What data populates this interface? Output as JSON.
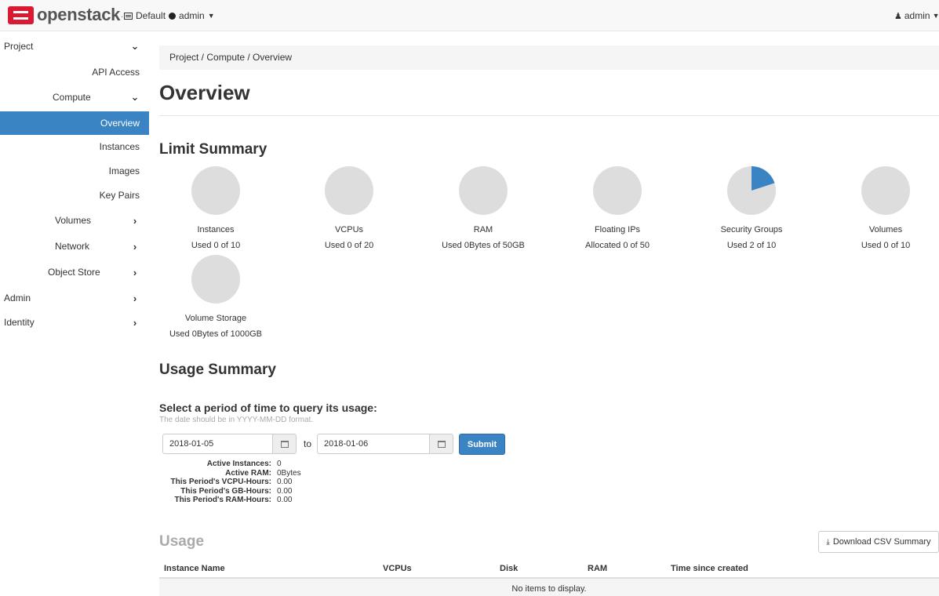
{
  "navbar": {
    "brand": "openstack",
    "brand_dot": ".",
    "domain": "Default",
    "project": "admin",
    "user": "admin"
  },
  "sidebar": {
    "items": [
      {
        "label": "Project",
        "chevron": "down"
      },
      {
        "label": "API Access"
      },
      {
        "label": "Compute",
        "chevron": "down"
      },
      {
        "label": "Overview",
        "active": true
      },
      {
        "label": "Instances"
      },
      {
        "label": "Images"
      },
      {
        "label": "Key Pairs"
      },
      {
        "label": "Volumes",
        "chevron": "right"
      },
      {
        "label": "Network",
        "chevron": "right"
      },
      {
        "label": "Object Store",
        "chevron": "right"
      },
      {
        "label": "Admin",
        "chevron": "right"
      },
      {
        "label": "Identity",
        "chevron": "right"
      }
    ]
  },
  "breadcrumb": "Project / Compute / Overview",
  "page_title": "Overview",
  "limit_summary": {
    "heading": "Limit Summary",
    "pies": [
      {
        "label": "Instances",
        "used_text": "Used 0 of 10",
        "used": 0,
        "total": 10
      },
      {
        "label": "VCPUs",
        "used_text": "Used 0 of 20",
        "used": 0,
        "total": 20
      },
      {
        "label": "RAM",
        "used_text": "Used 0Bytes of 50GB",
        "used": 0,
        "total": 50
      },
      {
        "label": "Floating IPs",
        "used_text": "Allocated 0 of 50",
        "used": 0,
        "total": 50
      },
      {
        "label": "Security Groups",
        "used_text": "Used 2 of 10",
        "used": 2,
        "total": 10
      },
      {
        "label": "Volumes",
        "used_text": "Used 0 of 10",
        "used": 0,
        "total": 10
      },
      {
        "label": "Volume Storage",
        "used_text": "Used 0Bytes of 1000GB",
        "used": 0,
        "total": 1000
      }
    ],
    "colors": {
      "empty": "#dddddd",
      "used": "#3b84c4"
    }
  },
  "usage_summary": {
    "heading": "Usage Summary",
    "period_heading": "Select a period of time to query its usage:",
    "hint": "The date should be in YYYY-MM-DD format.",
    "start_date": "2018-01-05",
    "to_label": "to",
    "end_date": "2018-01-06",
    "submit_label": "Submit",
    "stats": [
      {
        "key": "Active Instances:",
        "value": "0"
      },
      {
        "key": "Active RAM:",
        "value": "0Bytes"
      },
      {
        "key": "This Period's VCPU-Hours:",
        "value": "0.00"
      },
      {
        "key": "This Period's GB-Hours:",
        "value": "0.00"
      },
      {
        "key": "This Period's RAM-Hours:",
        "value": "0.00"
      }
    ]
  },
  "usage": {
    "heading": "Usage",
    "csv_button": "Download CSV Summary",
    "columns": [
      "Instance Name",
      "VCPUs",
      "Disk",
      "RAM",
      "Time since created"
    ],
    "empty_text": "No items to display."
  }
}
